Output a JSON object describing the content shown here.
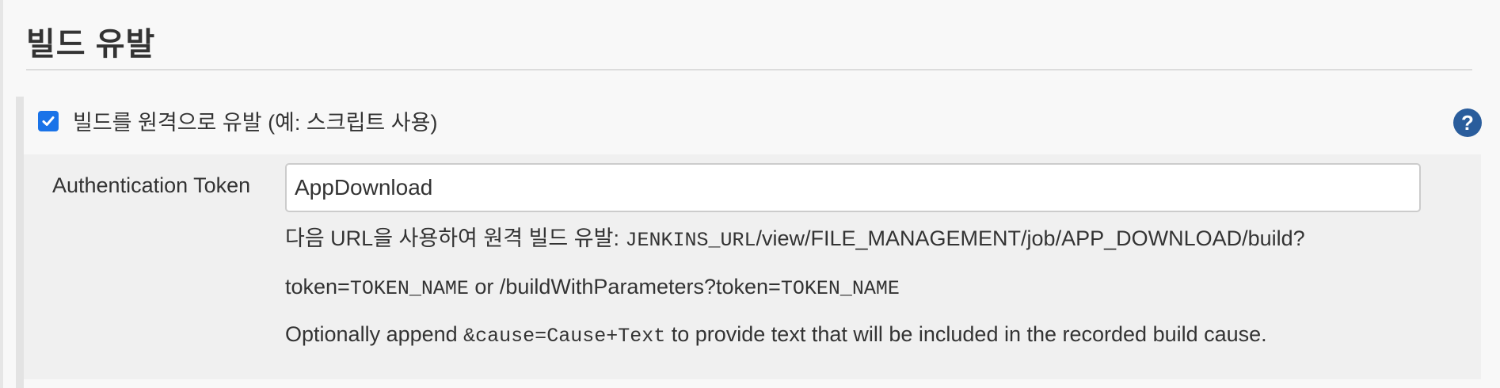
{
  "section": {
    "title": "빌드 유발"
  },
  "trigger_remote": {
    "checked": true,
    "label": "빌드를 원격으로 유발 (예: 스크립트 사용)",
    "help_symbol": "?"
  },
  "auth_token": {
    "label": "Authentication Token",
    "value": "AppDownload"
  },
  "help": {
    "line1_prefix": "다음 URL을 사용하여 원격 빌드 유발: ",
    "line1_var": "JENKINS_URL",
    "line1_path": "/view/FILE_MANAGEMENT/job/APP_DOWNLOAD/build?",
    "line2_param": "token=",
    "line2_var": "TOKEN_NAME",
    "line2_middle": " or /buildWithParameters?token=",
    "line2_var2": "TOKEN_NAME",
    "line3_prefix": "Optionally append ",
    "line3_code": "&cause=Cause+Text",
    "line3_suffix": " to provide text that will be included in the recorded build cause."
  },
  "colors": {
    "checkbox": "#1a73e8",
    "help_icon": "#2a5d9c",
    "panel_bg": "#f0f0f0",
    "page_bg": "#f8f8f8"
  }
}
